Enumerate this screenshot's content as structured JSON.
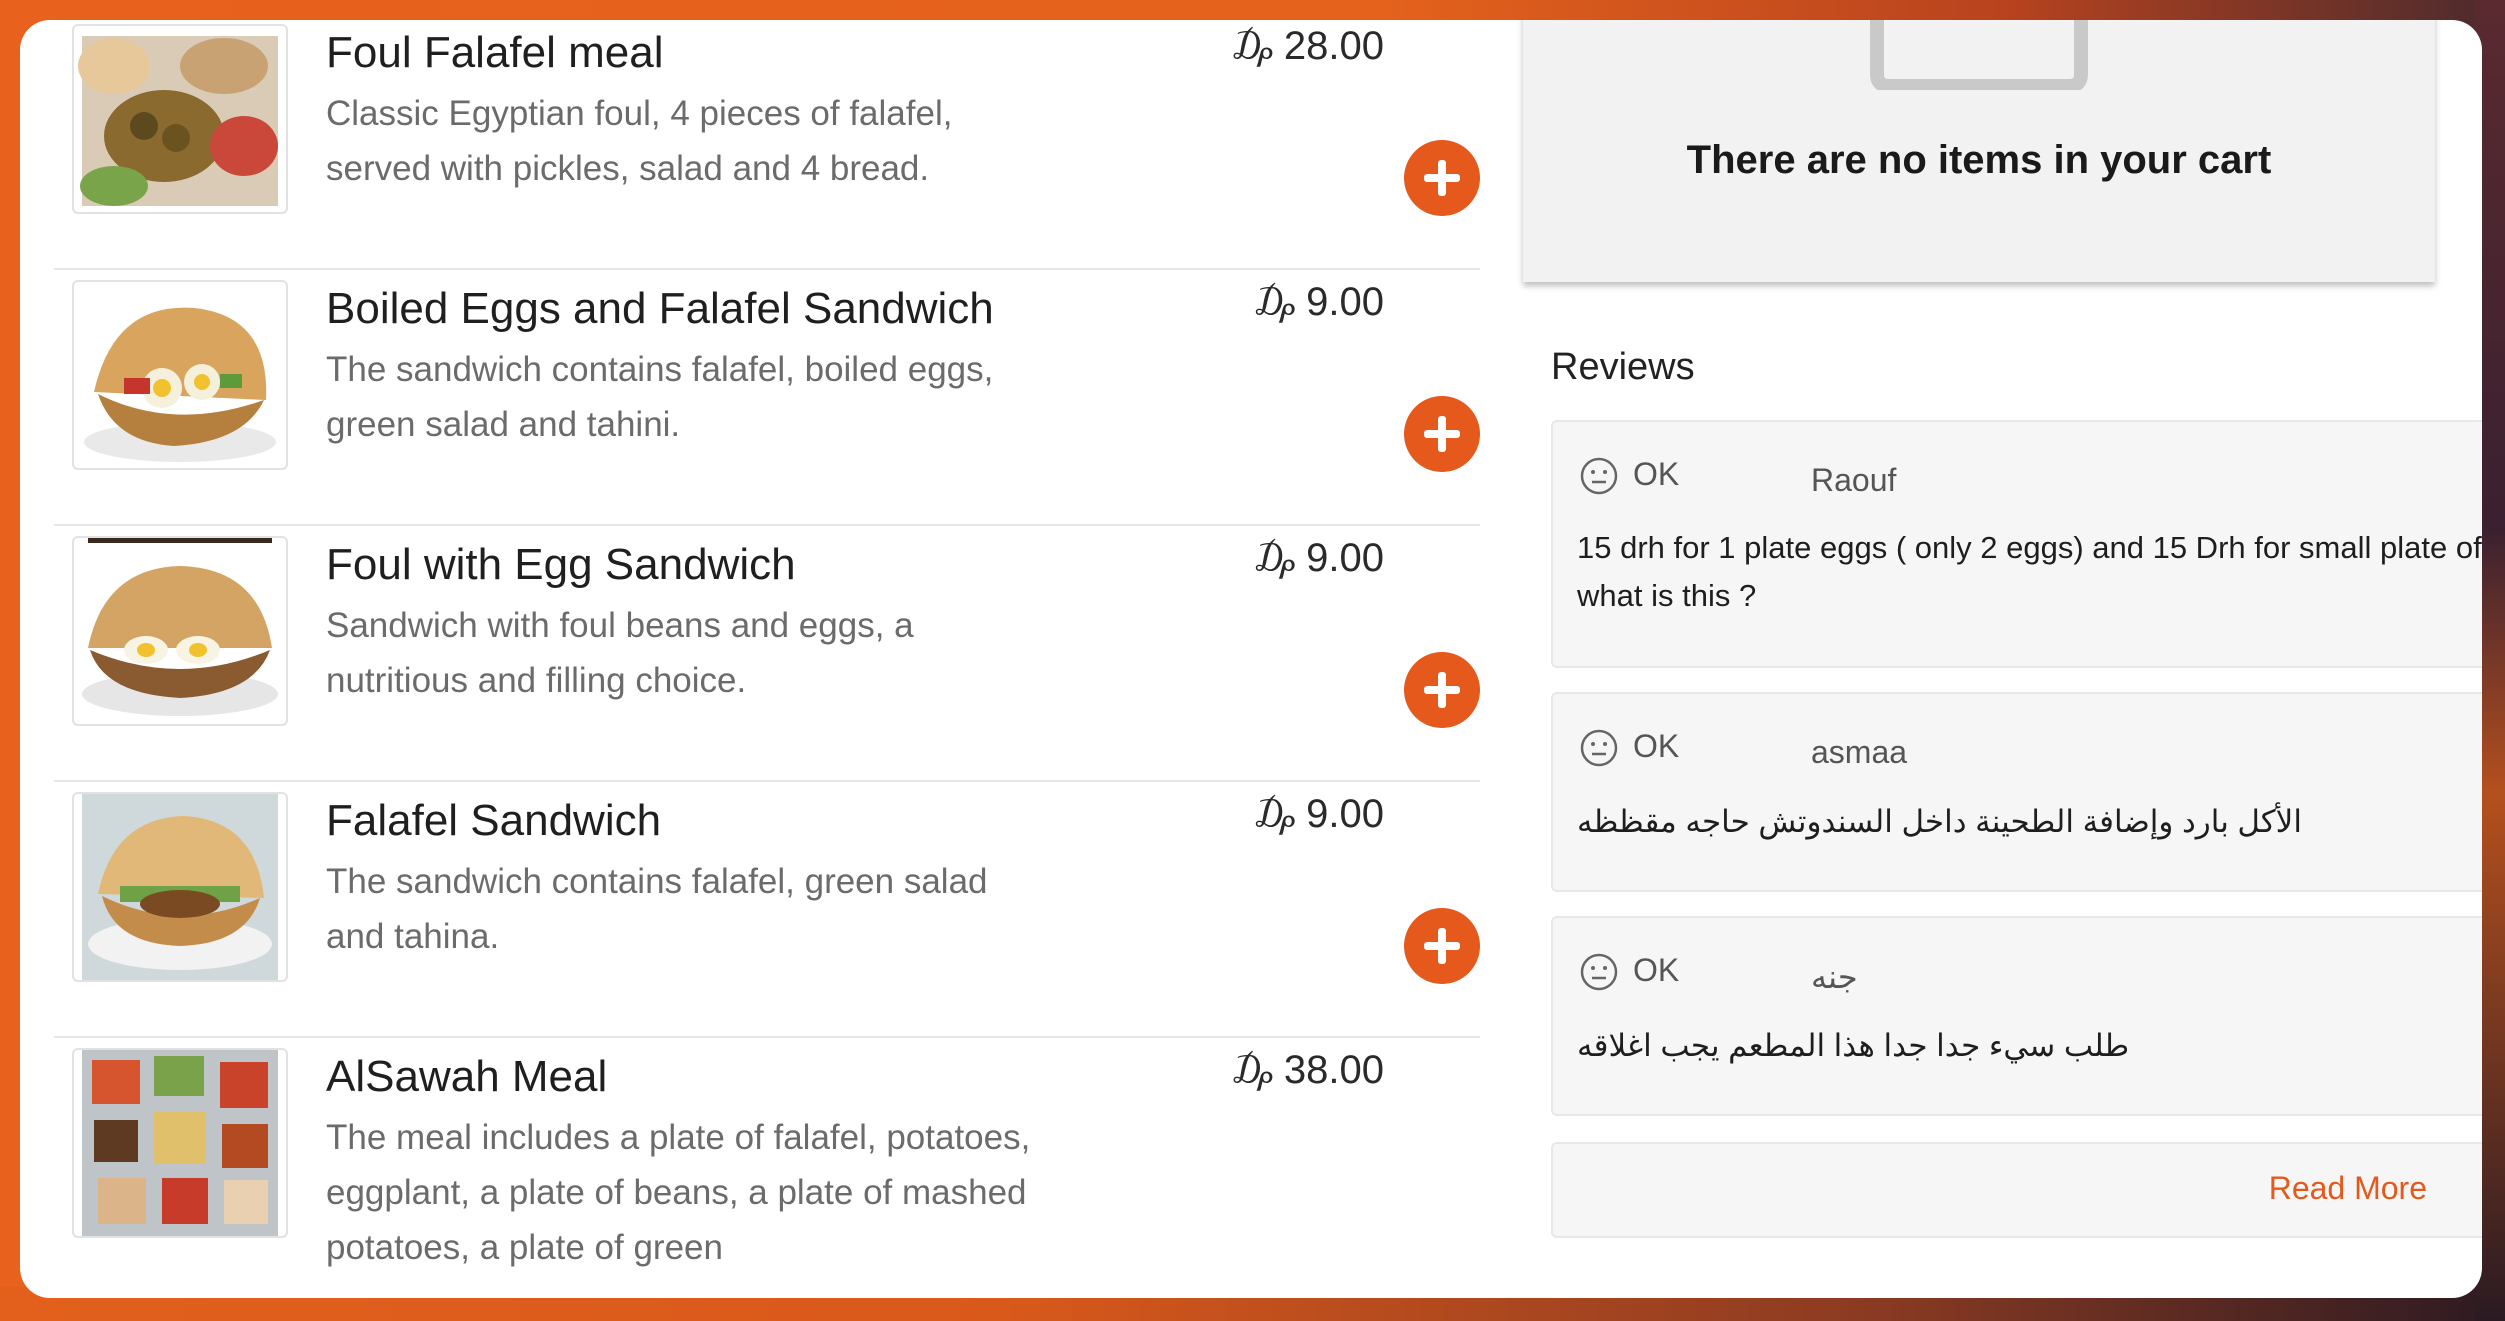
{
  "colors": {
    "accent": "#e5591c",
    "text": "#1f1f1f",
    "muted": "#6b6b6b"
  },
  "menu": {
    "items": [
      {
        "name": "Foul Falafel meal",
        "desc": "Classic Egyptian foul, 4 pieces of falafel, served with pickles, salad and 4 bread.",
        "price": "₯ 28.00"
      },
      {
        "name": "Boiled Eggs and Falafel Sandwich",
        "desc": "The sandwich contains falafel, boiled eggs, green salad and tahini.",
        "price": "₯ 9.00"
      },
      {
        "name": "Foul with Egg Sandwich",
        "desc": "Sandwich with foul beans and eggs, a nutritious and filling choice.",
        "price": "₯ 9.00"
      },
      {
        "name": "Falafel Sandwich",
        "desc": "The sandwich contains falafel, green salad and tahina.",
        "price": "₯ 9.00"
      },
      {
        "name": "AlSawah Meal",
        "desc": "The meal includes a plate of falafel, potatoes, eggplant, a plate of beans, a plate of mashed potatoes, a plate of green",
        "price": "₯ 38.00"
      }
    ],
    "add_icon": "plus-icon"
  },
  "cart": {
    "empty_message": "There are no items in your cart",
    "icon": "bag-icon"
  },
  "reviews": {
    "title": "Reviews",
    "items": [
      {
        "rating": "OK",
        "author": "Raouf",
        "text": "15 drh for 1 plate eggs ( only 2 eggs) and 15 Drh for small plate of what is this ?"
      },
      {
        "rating": "OK",
        "author": "asmaa",
        "text": "الأكل بارد وإضافة الطحينة داخل السندوتش حاجه مقظظه"
      },
      {
        "rating": "OK",
        "author": "جنه",
        "text": "طلب سيء جدا جدا هذا المطعم يجب اغلاقه"
      }
    ],
    "rating_icon": "neutral-face-icon",
    "read_more": "Read More"
  }
}
